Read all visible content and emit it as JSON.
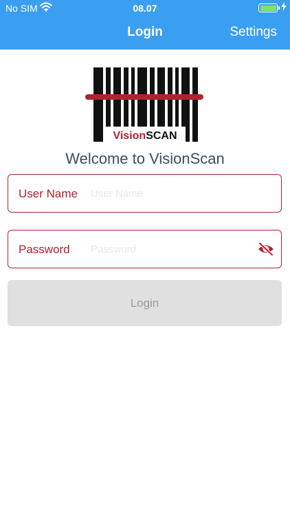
{
  "status_bar": {
    "carrier": "No SIM",
    "time": "08.07",
    "battery_level": 1.0,
    "icons": [
      "wifi-icon",
      "battery-icon",
      "charging-bolt-icon"
    ]
  },
  "nav": {
    "title": "Login",
    "settings_label": "Settings"
  },
  "logo": {
    "text_vision": "Vision",
    "text_scan": "SCAN",
    "accent_color": "#b3212f"
  },
  "welcome_text": "Welcome to VisionScan",
  "form": {
    "username": {
      "label": "User Name",
      "value": "",
      "placeholder": "User Name"
    },
    "password": {
      "label": "Password",
      "value": "",
      "placeholder": "Password",
      "toggle_icon": "eye-slash-icon"
    },
    "login_label": "Login"
  },
  "colors": {
    "header_bg": "#3a9ff0",
    "field_border": "#b3212f",
    "button_disabled_bg": "#e0e0e0",
    "welcome_text": "#3d4d5c"
  }
}
